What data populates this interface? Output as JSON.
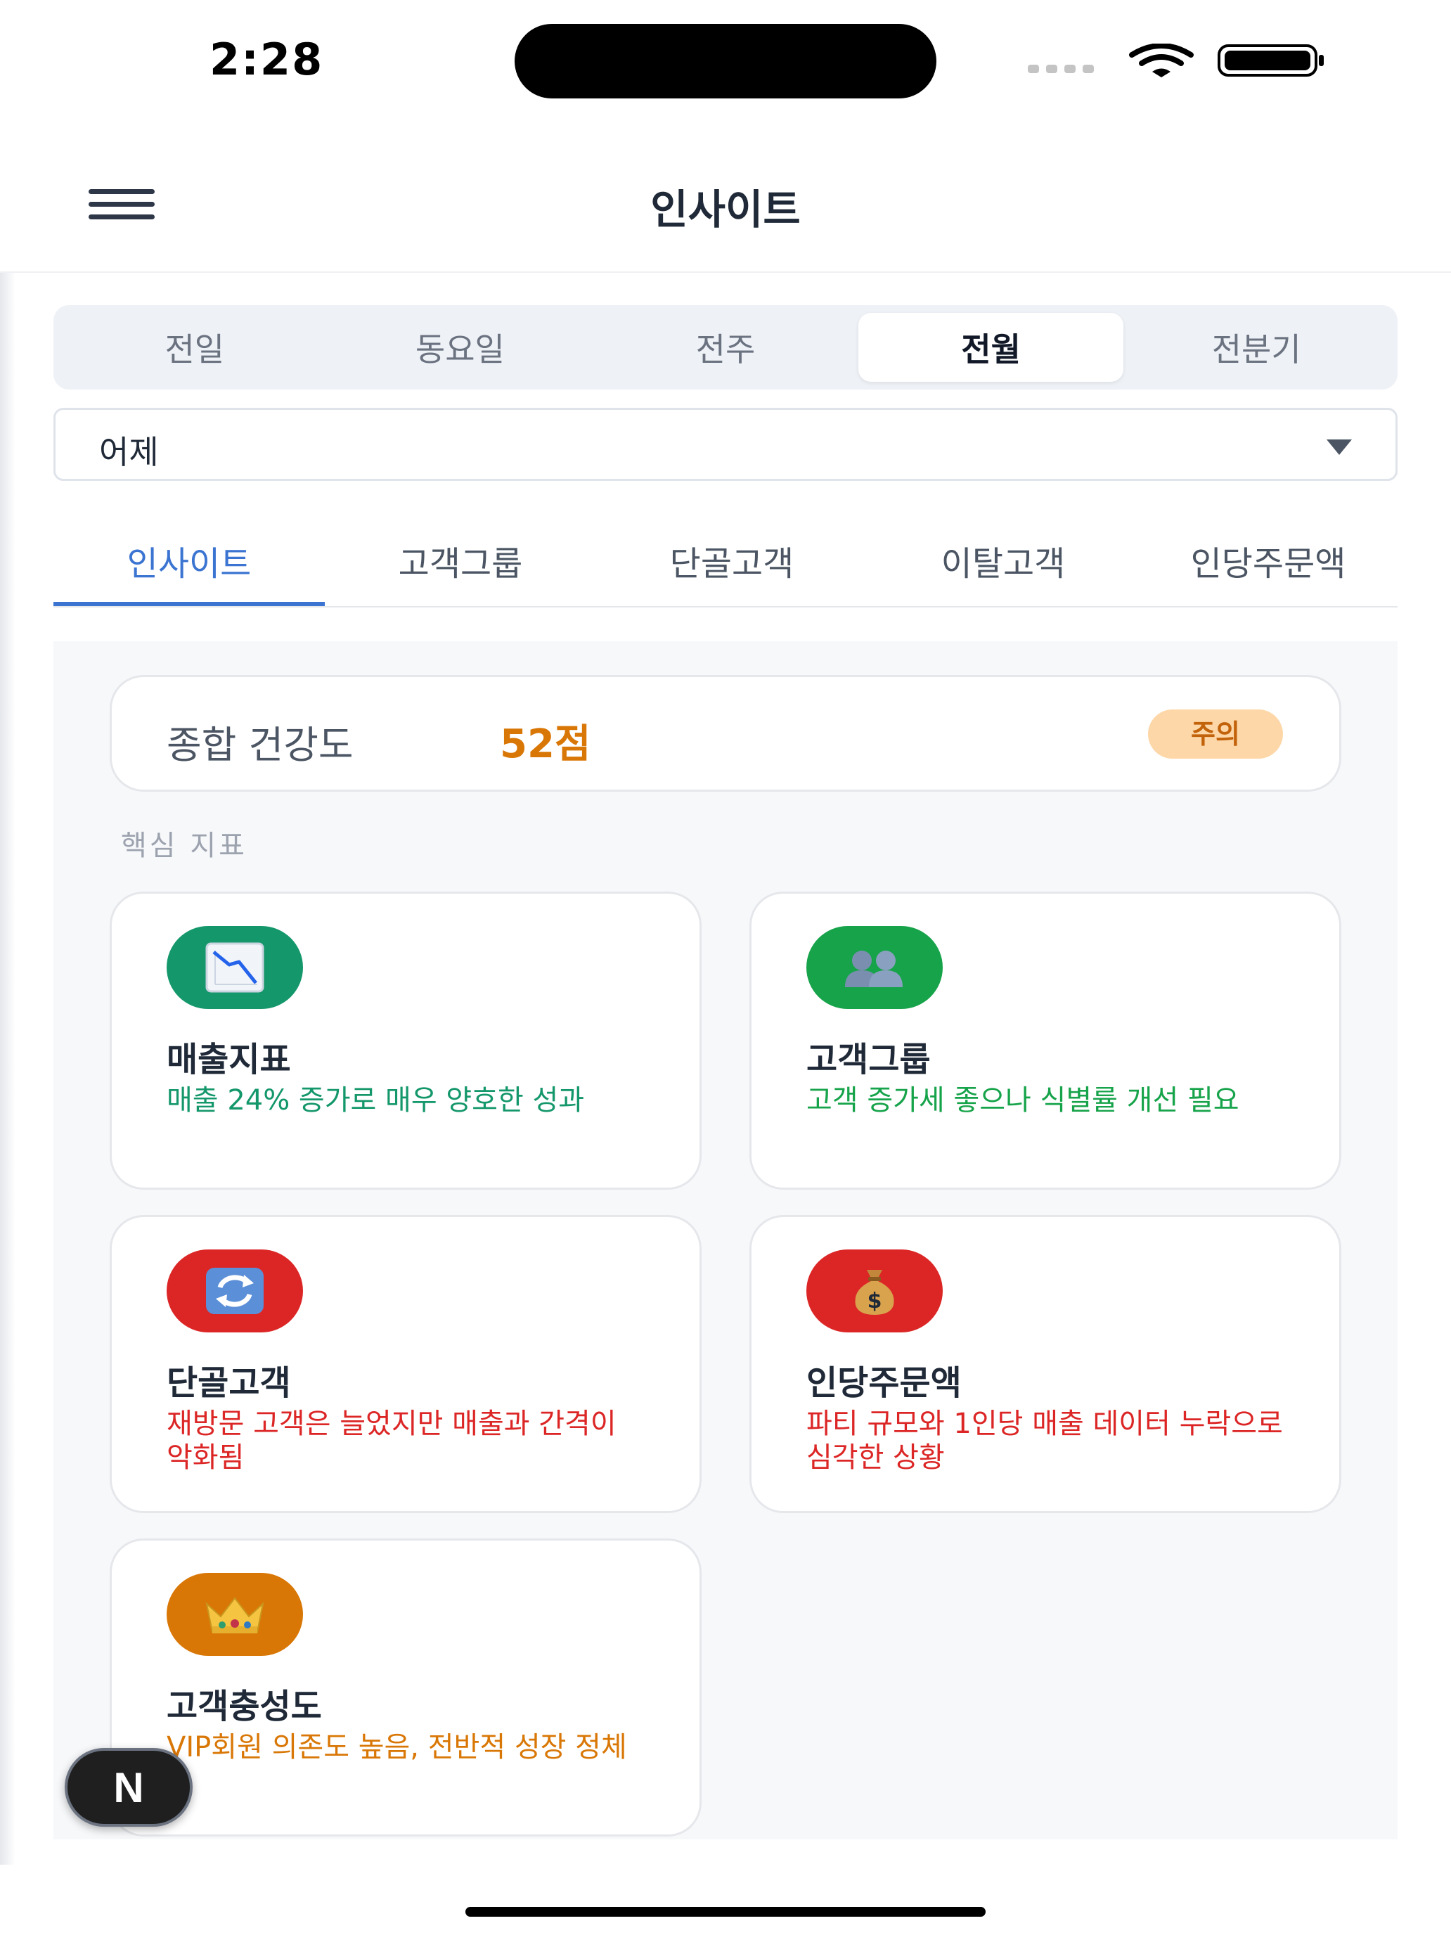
{
  "status_bar": {
    "time": "2:28"
  },
  "header": {
    "title": "인사이트"
  },
  "segment": {
    "items": [
      "전일",
      "동요일",
      "전주",
      "전월",
      "전분기"
    ],
    "selected": "전월"
  },
  "dropdown": {
    "value": "어제"
  },
  "tabs": {
    "items": [
      "인사이트",
      "고객그룹",
      "단골고객",
      "이탈고객",
      "인당주문액"
    ],
    "active": "인사이트"
  },
  "health": {
    "label": "종합 건강도",
    "score": "52점",
    "badge": "주의"
  },
  "section_label": "핵심 지표",
  "metrics": [
    {
      "title": "매출지표",
      "description": "매출 24% 증가로 매우 양호한 성과",
      "icon": "chart-down-icon",
      "icon_bg": "#14976a",
      "text_color": "#14976a"
    },
    {
      "title": "고객그룹",
      "description": "고객 증가세 좋으나 식별률 개선 필요",
      "icon": "people-icon",
      "icon_bg": "#16a34a",
      "text_color": "#16a34a"
    },
    {
      "title": "단골고객",
      "description": "재방문 고객은 늘었지만 매출과 간격이 악화됨",
      "icon": "repeat-icon",
      "icon_bg": "#dc2626",
      "text_color": "#dc2626"
    },
    {
      "title": "인당주문액",
      "description": "파티 규모와 1인당 매출 데이터 누락으로 심각한 상황",
      "icon": "money-bag-icon",
      "icon_bg": "#dc2626",
      "text_color": "#dc2626"
    },
    {
      "title": "고객충성도",
      "description": "VIP회원 의존도 높음, 전반적 성장 정체",
      "icon": "crown-icon",
      "icon_bg": "#d97706",
      "text_color": "#d97706"
    }
  ],
  "fab": {
    "label": "N"
  }
}
